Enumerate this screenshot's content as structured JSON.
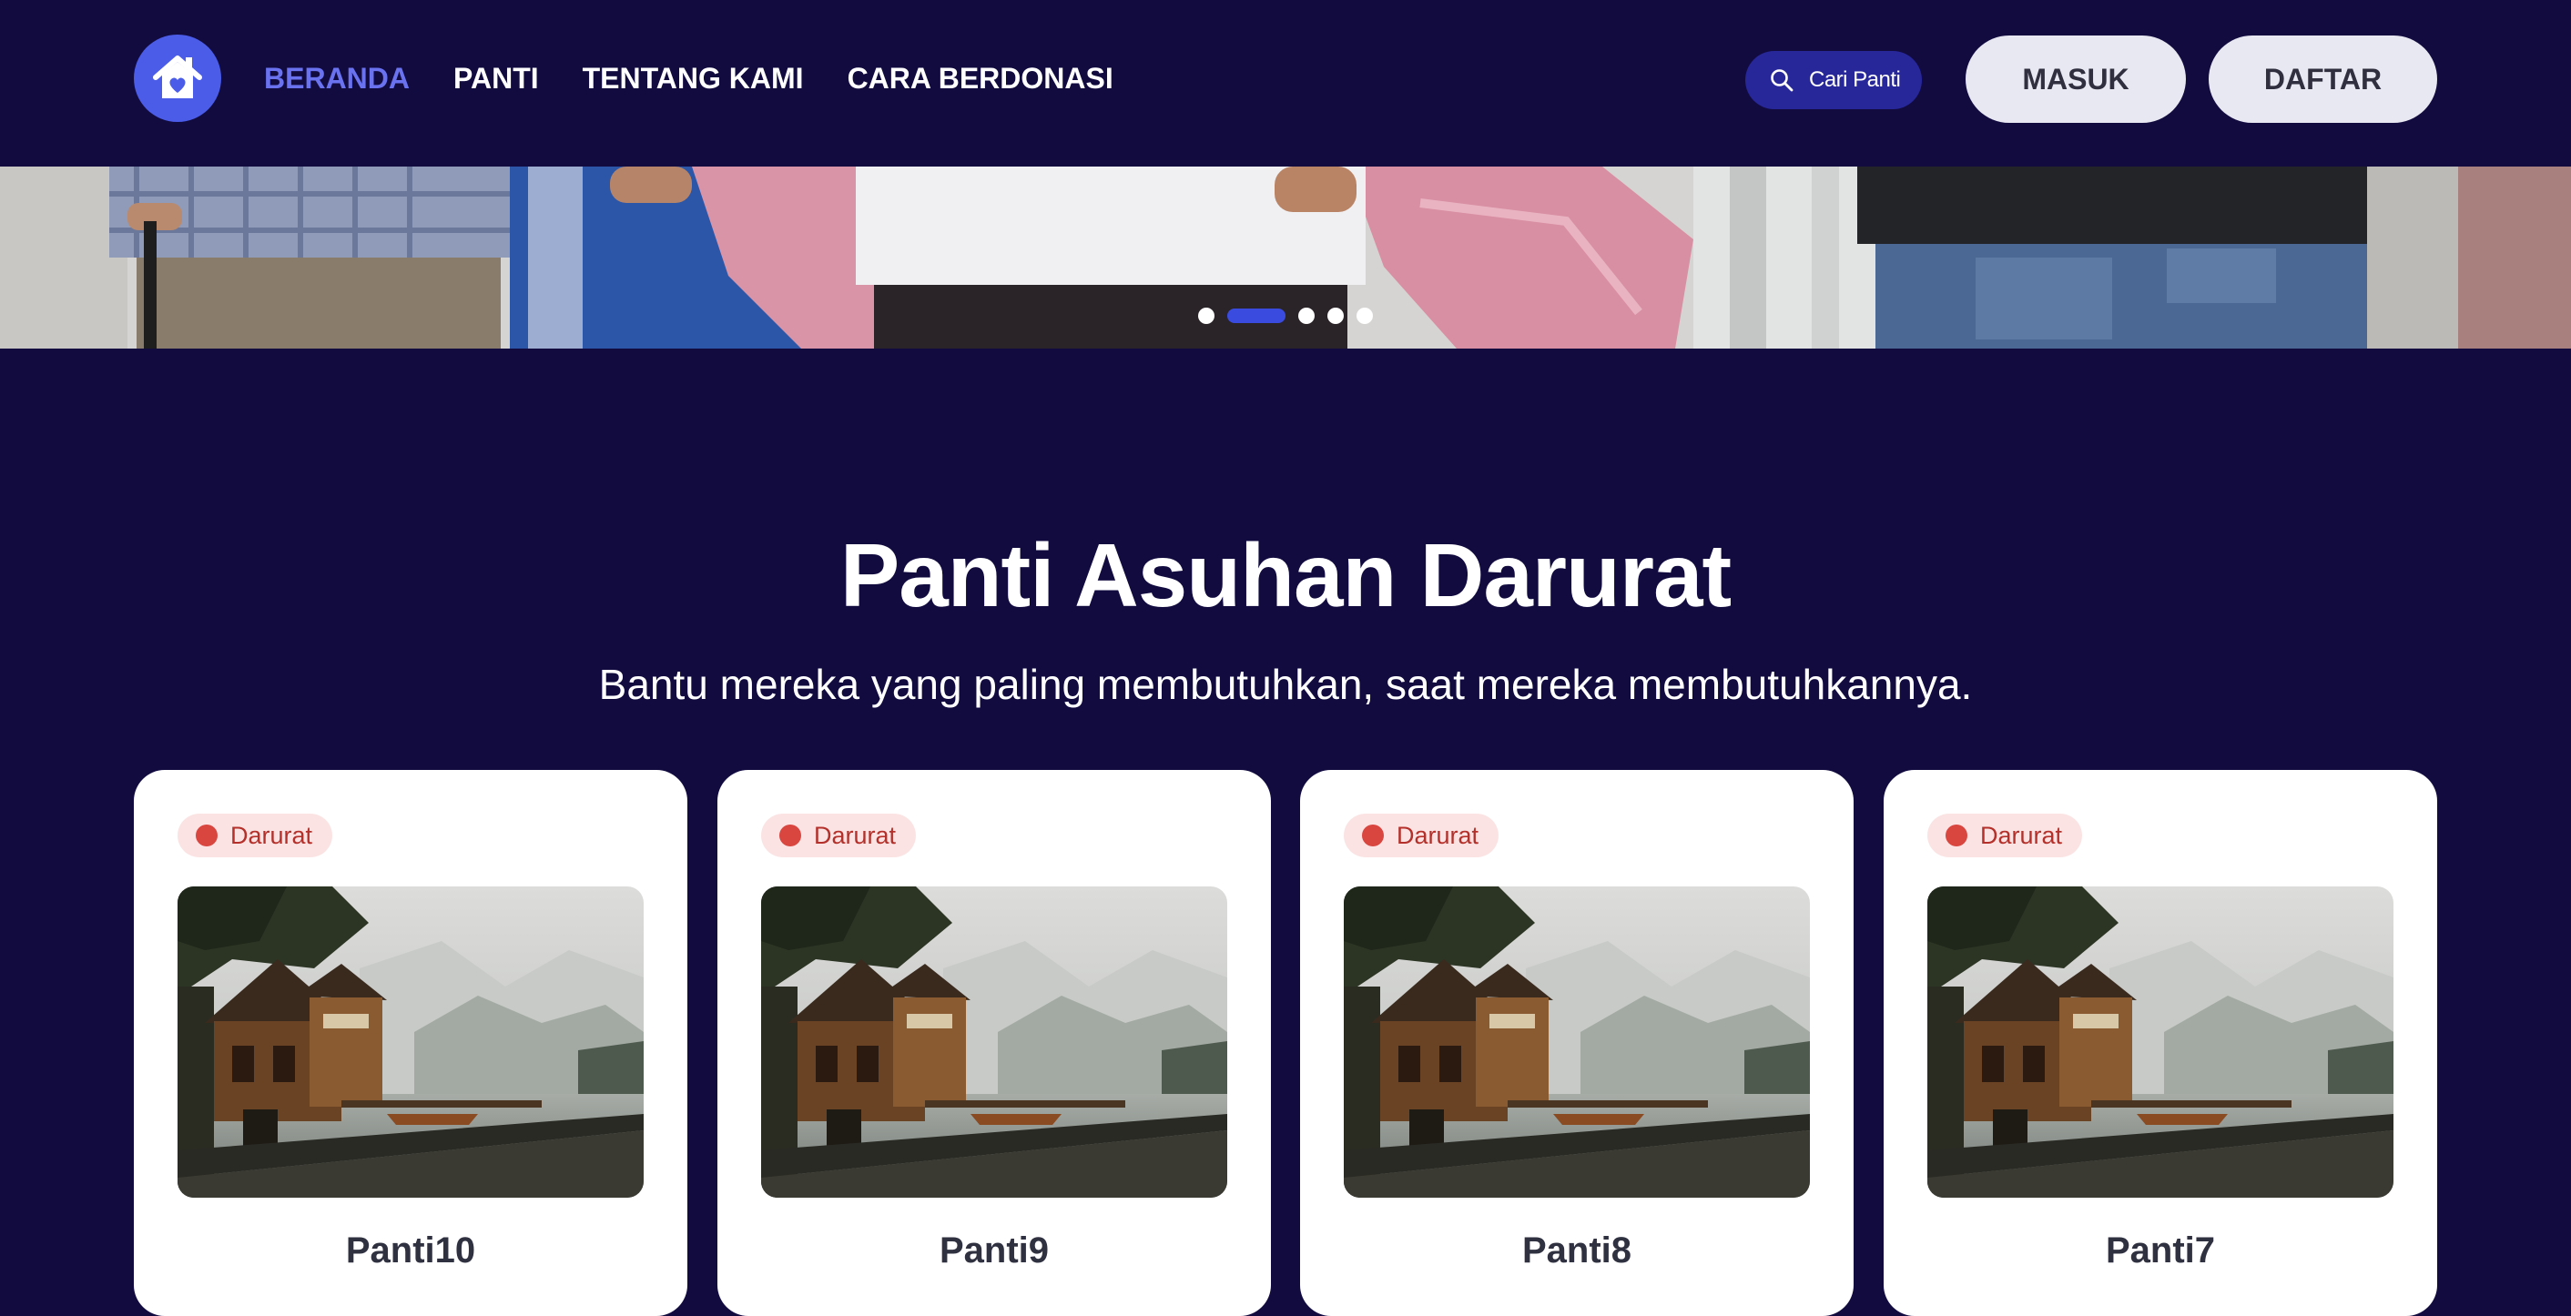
{
  "nav": {
    "links": [
      "BERANDA",
      "PANTI",
      "TENTANG KAMI",
      "CARA BERDONASI"
    ],
    "active": "BERANDA",
    "search_label": "Cari Panti",
    "login_label": "MASUK",
    "register_label": "DAFTAR",
    "colors": {
      "background": "#120b40",
      "accent": "#4a5ce8",
      "active_link": "#6a72f0"
    }
  },
  "hero": {
    "slide_count": 5,
    "active_slide": 2
  },
  "section": {
    "title": "Panti Asuhan Darurat",
    "subtitle": "Bantu mereka yang paling membutuhkan, saat mereka membutuhkannya."
  },
  "cards": [
    {
      "badge": "Darurat",
      "name": "Panti10"
    },
    {
      "badge": "Darurat",
      "name": "Panti9"
    },
    {
      "badge": "Darurat",
      "name": "Panti8"
    },
    {
      "badge": "Darurat",
      "name": "Panti7"
    }
  ],
  "colors": {
    "badge_bg": "#fbe3e3",
    "badge_dot": "#d9453f",
    "badge_text": "#b4302a"
  }
}
